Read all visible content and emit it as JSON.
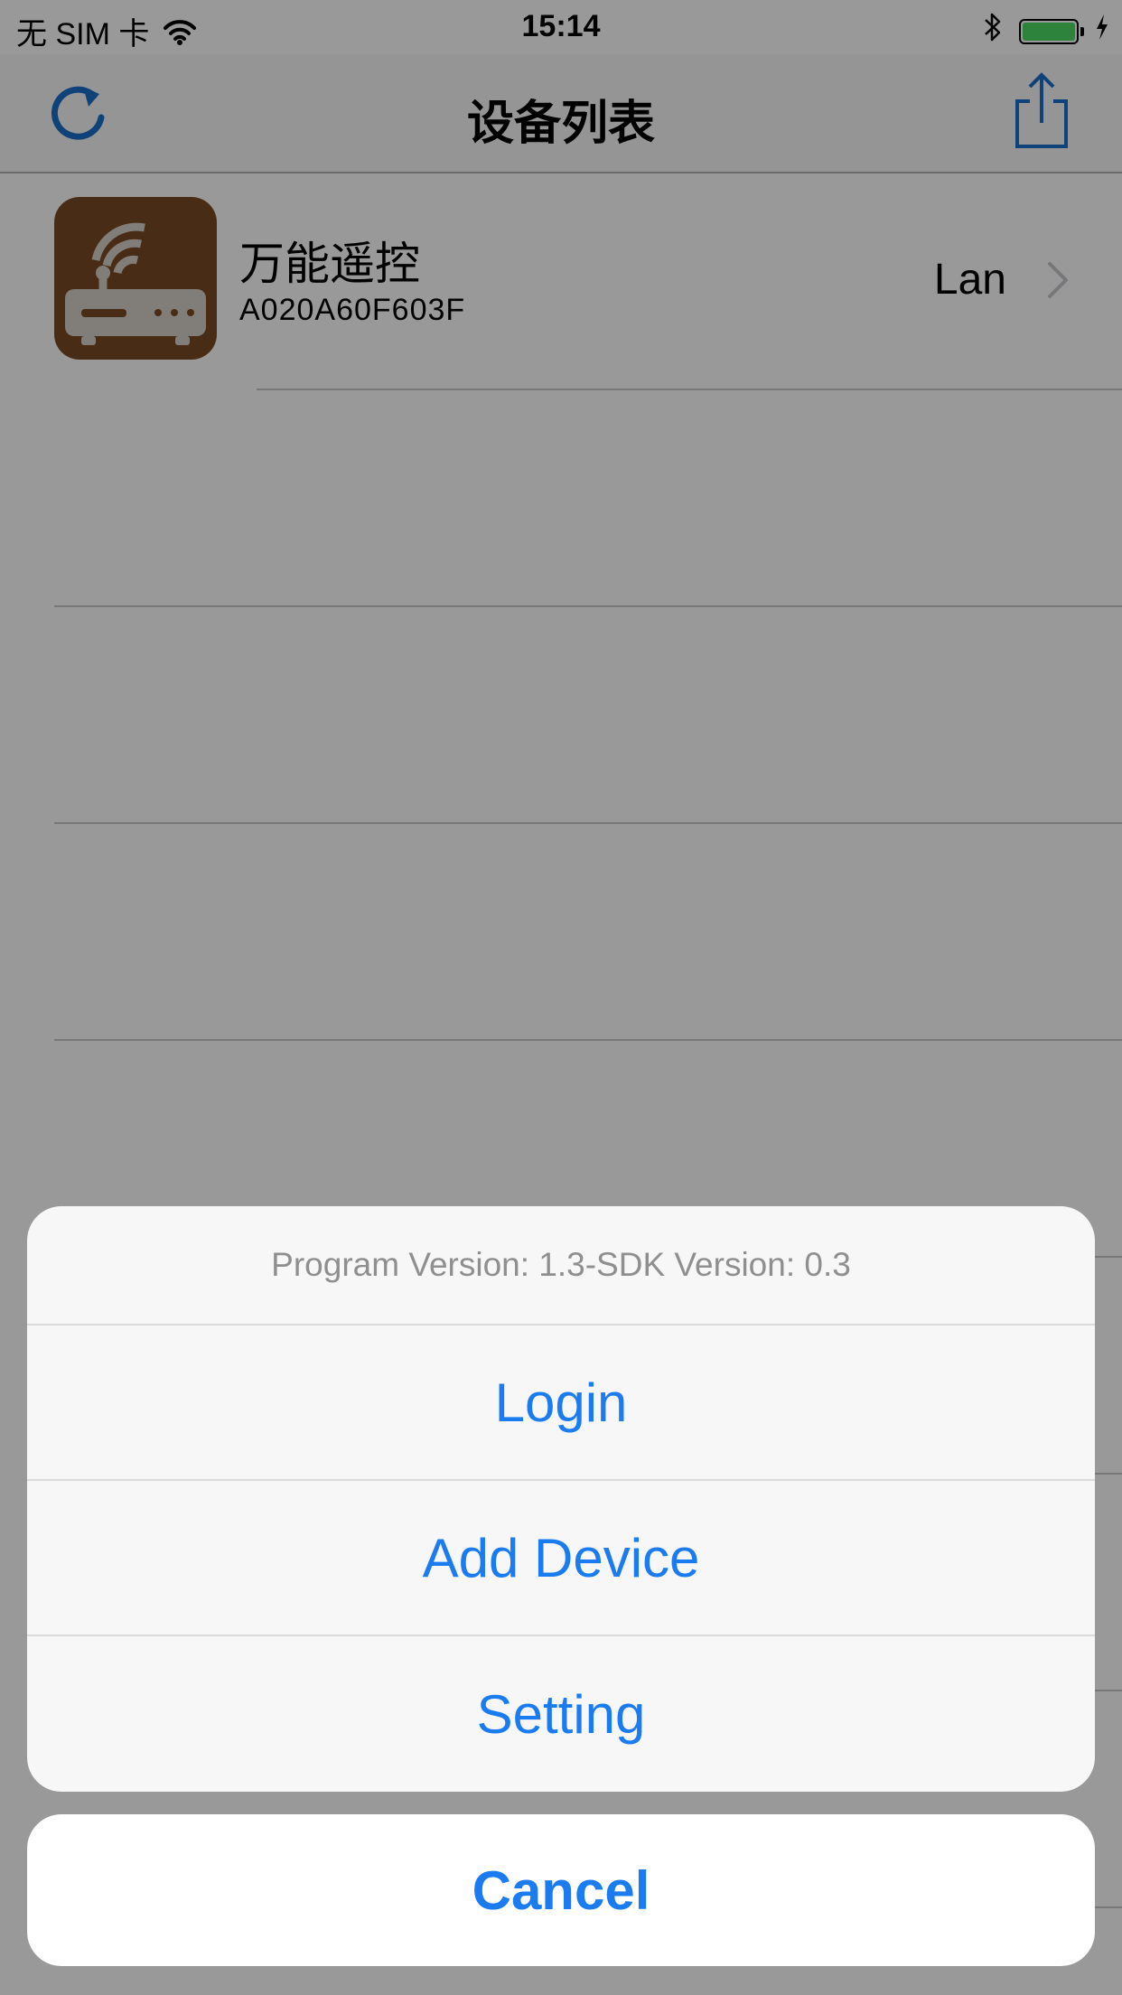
{
  "status_bar": {
    "carrier": "无 SIM 卡",
    "time": "15:14",
    "battery_level": 1.0,
    "battery_color": "#4cd964",
    "icons": [
      "wifi-icon",
      "bluetooth-icon",
      "battery-icon",
      "charging-bolt-icon"
    ]
  },
  "nav": {
    "title": "设备列表",
    "left_icon": "refresh-icon",
    "right_icon": "share-icon",
    "tint": "#1a6fc9"
  },
  "devices": [
    {
      "name": "万能遥控",
      "mac": "A020A60F603F",
      "connection": "Lan",
      "icon": "router-icon",
      "icon_color": "#7b4a23"
    }
  ],
  "action_sheet": {
    "message": "Program Version: 1.3-SDK Version: 0.3",
    "actions": [
      {
        "label": "Login"
      },
      {
        "label": "Add Device"
      },
      {
        "label": "Setting"
      }
    ],
    "cancel_label": "Cancel",
    "accent": "#1a7cf0"
  }
}
